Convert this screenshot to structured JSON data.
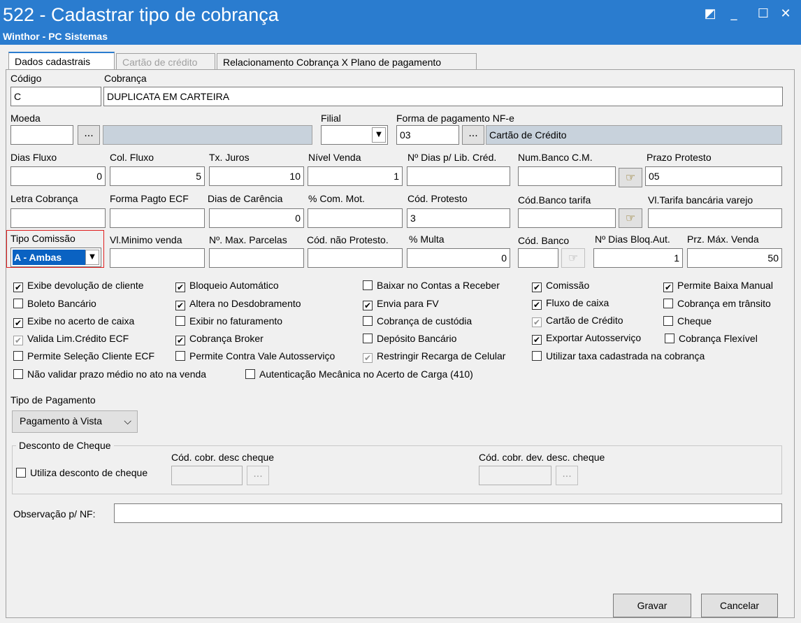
{
  "window": {
    "title": "522 - Cadastrar tipo de cobrança",
    "subtitle": "Winthor - PC Sistemas",
    "controls": [
      "restore-icon",
      "minimize-icon",
      "maximize-icon",
      "close-icon"
    ]
  },
  "tabs": [
    {
      "label": "Dados cadastrais",
      "state": "active"
    },
    {
      "label": "Cartão de crédito",
      "state": "disabled"
    },
    {
      "label": "Relacionamento Cobrança X Plano de pagamento",
      "state": "normal"
    }
  ],
  "fields": {
    "codigo": {
      "label": "Código",
      "value": "C"
    },
    "cobranca": {
      "label": "Cobrança",
      "value": "DUPLICATA EM CARTEIRA"
    },
    "moeda": {
      "label": "Moeda",
      "value": "",
      "desc": ""
    },
    "filial": {
      "label": "Filial",
      "value": ""
    },
    "forma_pag_nfe": {
      "label": "Forma de pagamento NF-e",
      "value": "03",
      "desc": "Cartão de Crédito"
    },
    "dias_fluxo": {
      "label": "Dias Fluxo",
      "value": "0"
    },
    "col_fluxo": {
      "label": "Col. Fluxo",
      "value": "5"
    },
    "tx_juros": {
      "label": "Tx. Juros",
      "value": "10"
    },
    "nivel_venda": {
      "label": "Nível Venda",
      "value": "1"
    },
    "n_dias_lib": {
      "label": "Nº Dias p/ Lib. Créd.",
      "value": ""
    },
    "num_banco_cm": {
      "label": "Num.Banco C.M.",
      "value": ""
    },
    "prazo_protesto": {
      "label": "Prazo Protesto",
      "value": "05"
    },
    "letra_cobranca": {
      "label": "Letra Cobrança",
      "value": ""
    },
    "forma_pagto_ecf": {
      "label": "Forma Pagto ECF",
      "value": ""
    },
    "dias_carencia": {
      "label": "Dias de Carência",
      "value": "0"
    },
    "com_mot": {
      "label": "% Com. Mot.",
      "value": ""
    },
    "cod_protesto": {
      "label": "Cód. Protesto",
      "value": "3"
    },
    "cod_banco_tarifa": {
      "label": "Cód.Banco tarifa",
      "value": ""
    },
    "vl_tarifa": {
      "label": "Vl.Tarifa bancária varejo",
      "value": ""
    },
    "tipo_comissao": {
      "label": "Tipo Comissão",
      "value": "A - Ambas"
    },
    "vl_minimo": {
      "label": "Vl.Minimo venda",
      "value": ""
    },
    "max_parcelas": {
      "label": "Nº. Max. Parcelas",
      "value": ""
    },
    "cod_nao_protesto": {
      "label": "Cód. não Protesto.",
      "value": ""
    },
    "multa": {
      "label": "% Multa",
      "value": "0"
    },
    "cod_banco": {
      "label": "Cód. Banco",
      "value": ""
    },
    "dias_bloq": {
      "label": "Nº Dias Bloq.Aut.",
      "value": "1"
    },
    "prz_max_venda": {
      "label": "Prz. Máx. Venda",
      "value": "50"
    }
  },
  "checkboxes": [
    {
      "label": "Exibe devolução de cliente",
      "checked": true,
      "disabled": false
    },
    {
      "label": "Bloqueio Automático",
      "checked": true,
      "disabled": false
    },
    {
      "label": "Baixar no Contas a Receber",
      "checked": false,
      "disabled": false
    },
    {
      "label": "Comissão",
      "checked": true,
      "disabled": false
    },
    {
      "label": "Permite Baixa Manual",
      "checked": true,
      "disabled": false
    },
    {
      "label": "Boleto Bancário",
      "checked": false,
      "disabled": false
    },
    {
      "label": "Altera no Desdobramento",
      "checked": true,
      "disabled": false
    },
    {
      "label": "Envia para FV",
      "checked": true,
      "disabled": false
    },
    {
      "label": "Fluxo de caixa",
      "checked": true,
      "disabled": false
    },
    {
      "label": "Cobrança em trânsito",
      "checked": false,
      "disabled": false
    },
    {
      "label": "Exibe no acerto de caixa",
      "checked": true,
      "disabled": false
    },
    {
      "label": "Exibir no faturamento",
      "checked": false,
      "disabled": false
    },
    {
      "label": "Cobrança de custódia",
      "checked": false,
      "disabled": false
    },
    {
      "label": "Cartão de Crédito",
      "checked": true,
      "disabled": true
    },
    {
      "label": "Cheque",
      "checked": false,
      "disabled": false
    },
    {
      "label": "Valida Lim.Crédito ECF",
      "checked": true,
      "disabled": true
    },
    {
      "label": "Cobrança Broker",
      "checked": true,
      "disabled": false
    },
    {
      "label": "Depósito Bancário",
      "checked": false,
      "disabled": false
    },
    {
      "label": "Exportar Autosserviço",
      "checked": true,
      "disabled": false
    },
    {
      "label": "Cobrança Flexível",
      "checked": false,
      "disabled": false
    },
    {
      "label": "Permite Seleção Cliente ECF",
      "checked": false,
      "disabled": false
    },
    {
      "label": "Permite Contra Vale Autosserviço",
      "checked": false,
      "disabled": false
    },
    {
      "label": "Restringir Recarga de Celular",
      "checked": true,
      "disabled": true
    },
    {
      "label": "Utilizar taxa cadastrada na cobrança",
      "checked": false,
      "disabled": false
    },
    {
      "label": "Não validar prazo médio no ato na venda",
      "checked": false,
      "disabled": false
    },
    {
      "label": "Autenticação Mecânica no Acerto de Carga (410)",
      "checked": false,
      "disabled": false
    }
  ],
  "tipo_pagamento": {
    "label": "Tipo de Pagamento",
    "value": "Pagamento à Vista"
  },
  "desconto_cheque": {
    "group_label": "Desconto de Cheque",
    "utiliza": {
      "label": "Utiliza desconto de cheque",
      "checked": false
    },
    "cod_cobr_desc": {
      "label": "Cód. cobr. desc cheque",
      "value": ""
    },
    "cod_cobr_dev": {
      "label": "Cód. cobr. dev. desc. cheque",
      "value": ""
    }
  },
  "observacao": {
    "label": "Observação p/ NF:",
    "value": ""
  },
  "buttons": {
    "gravar": "Gravar",
    "cancelar": "Cancelar",
    "ellipsis": "..."
  },
  "colors": {
    "titlebar": "#2a7ccf",
    "highlight": "#e02020",
    "selection": "#0a62c2"
  }
}
